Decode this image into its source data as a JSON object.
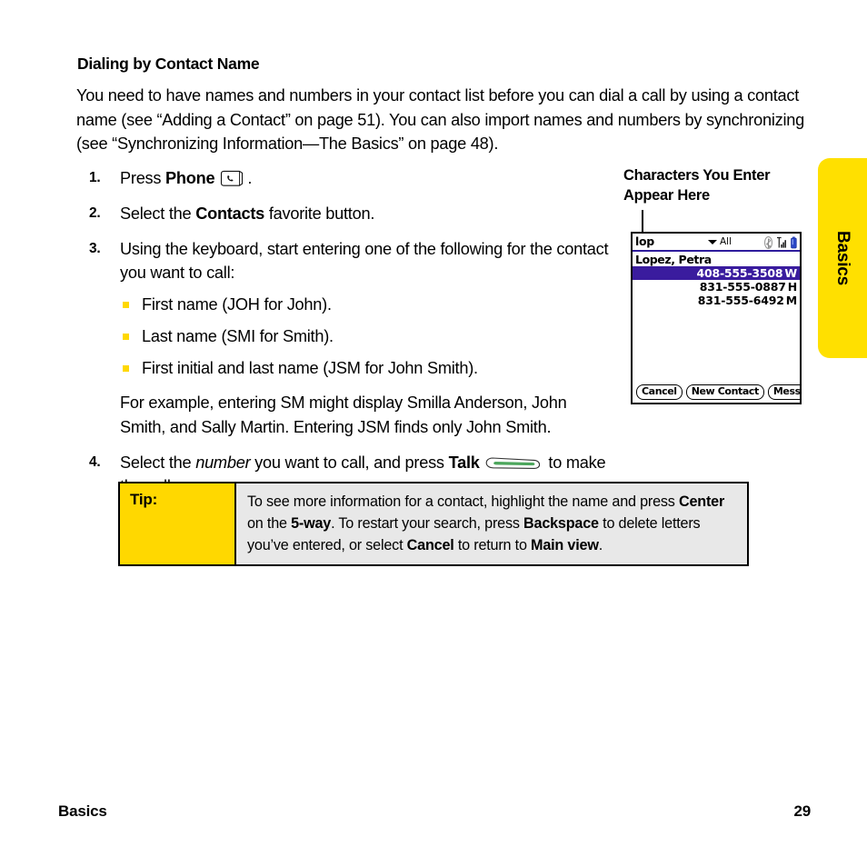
{
  "document": {
    "section_heading": "Dialing by Contact Name",
    "intro_paragraph": "You need to have names and numbers in your contact list before you can dial a call by using a contact name (see “Adding a Contact” on page 51). You can also import names and numbers by synchronizing (see “Synchronizing Information—The Basics” on page 48).",
    "footer": {
      "left": "Basics",
      "page_number": "29"
    },
    "side_tab": {
      "label": "Basics",
      "color": "#FFE000"
    }
  },
  "steps": [
    {
      "number": "1.",
      "text_before": "Press ",
      "bold": "Phone",
      "icon": "phone-key-icon",
      "text_after": "."
    },
    {
      "number": "2.",
      "text_before": "Select the ",
      "bold": "Contacts",
      "text_after": " favorite button."
    },
    {
      "number": "3.",
      "text_before": "Using the keyboard, start entering one of the following for the contact you want to call:",
      "sub_items": [
        "First name (JOH for John).",
        "Last name (SMI for Smith).",
        "First initial and last name (JSM for John Smith)."
      ],
      "paragraph": "For example, entering SM might display Smilla Anderson, John Smith, and Sally Martin. Entering JSM finds only John Smith."
    },
    {
      "number": "4.",
      "text_before": "Select the ",
      "italic": "number",
      "text_middle": " you want to call, and press ",
      "bold": "Talk",
      "icon": "talk-key-icon",
      "text_after": " to make the call."
    }
  ],
  "callout": {
    "line1": "Characters You Enter",
    "line2": "Appear Here"
  },
  "device_screen": {
    "search_query": "lop",
    "filter_label": "All",
    "status_icons": [
      "bluetooth-icon",
      "signal-strength-icon",
      "battery-icon"
    ],
    "contact_name": "Lopez, Petra",
    "numbers": [
      {
        "number": "408-555-3508",
        "type": "W",
        "selected": true
      },
      {
        "number": "831-555-0887",
        "type": "H",
        "selected": false
      },
      {
        "number": "831-555-6492",
        "type": "M",
        "selected": false
      }
    ],
    "buttons": [
      "Cancel",
      "New Contact",
      "Message"
    ],
    "highlight_color": "#3A1C9E"
  },
  "tip": {
    "label": "Tip:",
    "segments": [
      {
        "text": "To see more information for a contact, highlight the name and press ",
        "bold": false
      },
      {
        "text": "Center",
        "bold": true
      },
      {
        "text": " on the ",
        "bold": false
      },
      {
        "text": "5-way",
        "bold": true
      },
      {
        "text": ". To restart your search, press ",
        "bold": false
      },
      {
        "text": "Backspace",
        "bold": true
      },
      {
        "text": " to delete letters you’ve entered, or select ",
        "bold": false
      },
      {
        "text": "Cancel",
        "bold": true
      },
      {
        "text": " to return to ",
        "bold": false
      },
      {
        "text": "Main view",
        "bold": true
      },
      {
        "text": ".",
        "bold": false
      }
    ]
  }
}
